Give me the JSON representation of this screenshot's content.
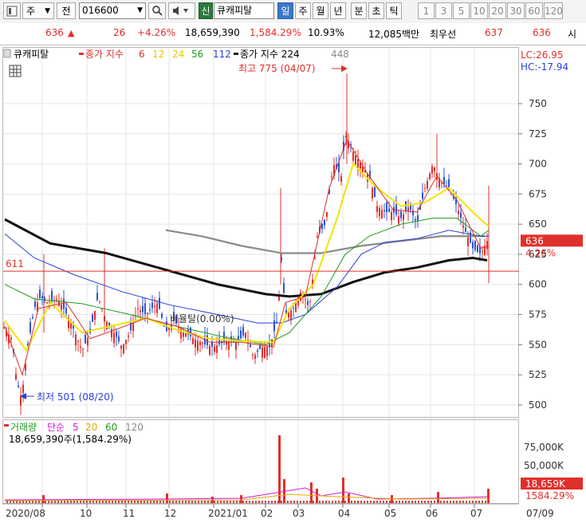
{
  "toolbar": {
    "type_label": "주",
    "prev_label": "전",
    "code": "016600",
    "market_badge": "신",
    "stock_name": "큐캐피탈",
    "periods": [
      "일",
      "주",
      "월",
      "년",
      "분",
      "초",
      "틱"
    ],
    "selected_period": "일",
    "intervals": [
      "1",
      "3",
      "5",
      "10",
      "20",
      "30",
      "60",
      "120"
    ]
  },
  "quote": {
    "price": "636",
    "arrow": "▲",
    "change": "26",
    "change_pct": "+4.26%",
    "volume": "18,659,390",
    "volume_ratio": "1,584.29%",
    "turnover": "10.93%",
    "amount": "12,085백만",
    "best_ask_label": "최우선",
    "best_ask": "637",
    "best_bid": "636",
    "market_label": "시"
  },
  "chart_data": {
    "type": "line",
    "price_legend": {
      "name": "큐캐피탈",
      "ma_label": "종가 지수",
      "ma_periods": [
        {
          "value": "6",
          "color": "#e0302b"
        },
        {
          "value": "12",
          "color": "#e6c800"
        },
        {
          "value": "24",
          "color": "#e6c800"
        },
        {
          "value": "56",
          "color": "#1f9b1f"
        },
        {
          "value": "112",
          "color": "#2a3fd6"
        }
      ],
      "ma2_label": "종가 지수 224",
      "ma2_period": "448"
    },
    "lc_label": "LC:26.95",
    "hc_label": "HC:-17.94",
    "y_ticks": [
      "750",
      "725",
      "700",
      "675",
      "650",
      "625",
      "600",
      "575",
      "550",
      "525",
      "500"
    ],
    "ylim": [
      490,
      795
    ],
    "current_price_tag": "636",
    "current_pct_tag": "4.26%",
    "ref_line_label": "611",
    "ref_line_value": 611,
    "high_label": "최고 775 (04/07)",
    "low_label": "최저 501 (08/20)",
    "ratio_label": "비율탈(0.00%)",
    "x_ticks": [
      "2020/08",
      "10",
      "11",
      "12",
      "2021/01",
      "02",
      "03",
      "04",
      "05",
      "06",
      "07"
    ],
    "x_end_label": "07/09",
    "series": [
      {
        "name": "MA6",
        "color": "#e0302b"
      },
      {
        "name": "MA12",
        "color": "#f2e400"
      },
      {
        "name": "MA56",
        "color": "#1f9b1f"
      },
      {
        "name": "MA112",
        "color": "#2a3fd6"
      },
      {
        "name": "MA224",
        "color": "#111111"
      },
      {
        "name": "MA448",
        "color": "#8a8a8a"
      }
    ],
    "volume": {
      "legend_label": "거래량",
      "ma_label": "단순",
      "ma_periods": [
        {
          "value": "5",
          "color": "#d11ad1"
        },
        {
          "value": "20",
          "color": "#e6a800"
        },
        {
          "value": "60",
          "color": "#1f9b1f"
        },
        {
          "value": "120",
          "color": "#888888"
        }
      ],
      "info": "18,659,390주(1,584.29%)",
      "y_ticks": [
        "75,000K",
        "50,000K"
      ],
      "current_tag": "18,659K",
      "current_pct": "1584.29%"
    }
  }
}
